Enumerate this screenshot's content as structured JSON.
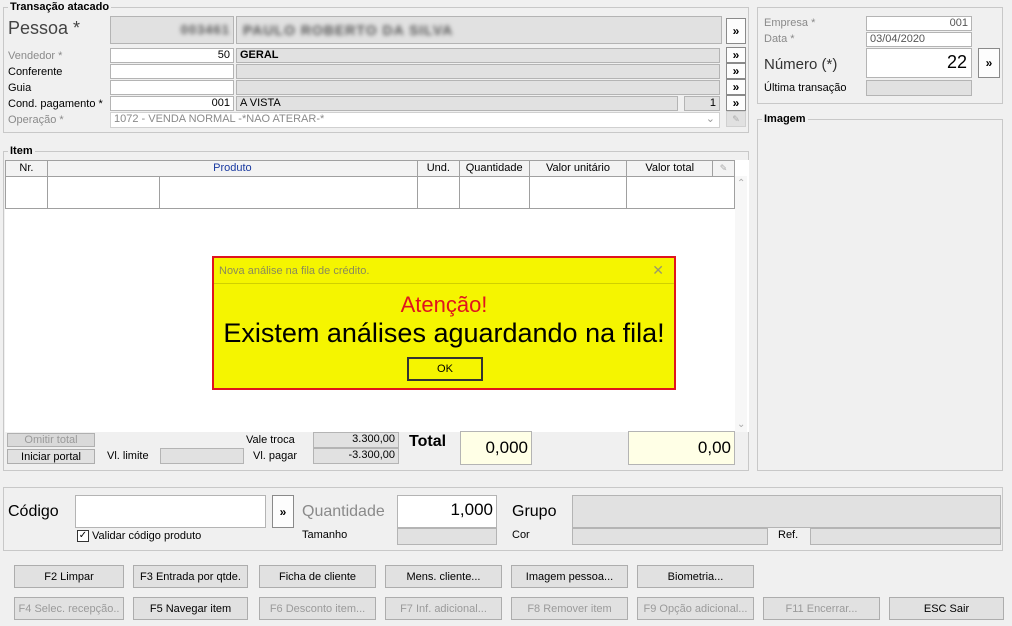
{
  "transacao": {
    "title": "Transação atacado",
    "pessoa_label": "Pessoa *",
    "pessoa_code": "003461",
    "pessoa_name": "PAULO ROBERTO DA SILVA",
    "vendedor_label": "Vendedor *",
    "vendedor_code": "50",
    "vendedor_name": "GERAL",
    "conferente_label": "Conferente",
    "guia_label": "Guia",
    "cond_label": "Cond. pagamento *",
    "cond_code": "001",
    "cond_name": "A VISTA",
    "cond_num": "1",
    "operacao_label": "Operação *",
    "operacao_value": "1072 - VENDA NORMAL -*NAO ATERAR-*",
    "more": "»"
  },
  "right_panel": {
    "empresa_label": "Empresa *",
    "empresa_value": "001",
    "data_label": "Data *",
    "data_value": "03/04/2020",
    "numero_label": "Número (*)",
    "numero_value": "22",
    "ultima_label": "Última transação",
    "imagem_title": "Imagem"
  },
  "item": {
    "title": "Item",
    "columns": [
      "Nr.",
      "Produto",
      "Und.",
      "Quantidade",
      "Valor unitário",
      "Valor total"
    ]
  },
  "totals": {
    "omitir_label": "Omitir total",
    "iniciar_label": "Iniciar portal",
    "vl_limite_label": "Vl. limite",
    "vale_troca_label": "Vale troca",
    "vale_troca_value": "3.300,00",
    "vl_pagar_label": "Vl. pagar",
    "vl_pagar_value": "-3.300,00",
    "total_label": "Total",
    "total_qty": "0,000",
    "total_value": "0,00"
  },
  "codigo": {
    "codigo_label": "Código",
    "validar_label": "Validar código produto",
    "quantidade_label": "Quantidade",
    "quantidade_value": "1,000",
    "tamanho_label": "Tamanho",
    "grupo_label": "Grupo",
    "cor_label": "Cor",
    "ref_label": "Ref."
  },
  "buttons_row1": [
    "F2 Limpar",
    "F3 Entrada por qtde.",
    "Ficha de cliente",
    "Mens. cliente...",
    "Imagem pessoa...",
    "Biometria..."
  ],
  "buttons_row2": [
    "F4 Selec. recepção..",
    "F5 Navegar item",
    "F6 Desconto item...",
    "F7 Inf. adicional...",
    "F8 Remover item",
    "F9 Opção adicional...",
    "F11 Encerrar...",
    "ESC Sair"
  ],
  "dialog": {
    "title": "Nova análise na fila de crédito.",
    "line1": "Atenção!",
    "line2": "Existem análises aguardando na fila!",
    "ok": "OK",
    "close": "✕"
  }
}
